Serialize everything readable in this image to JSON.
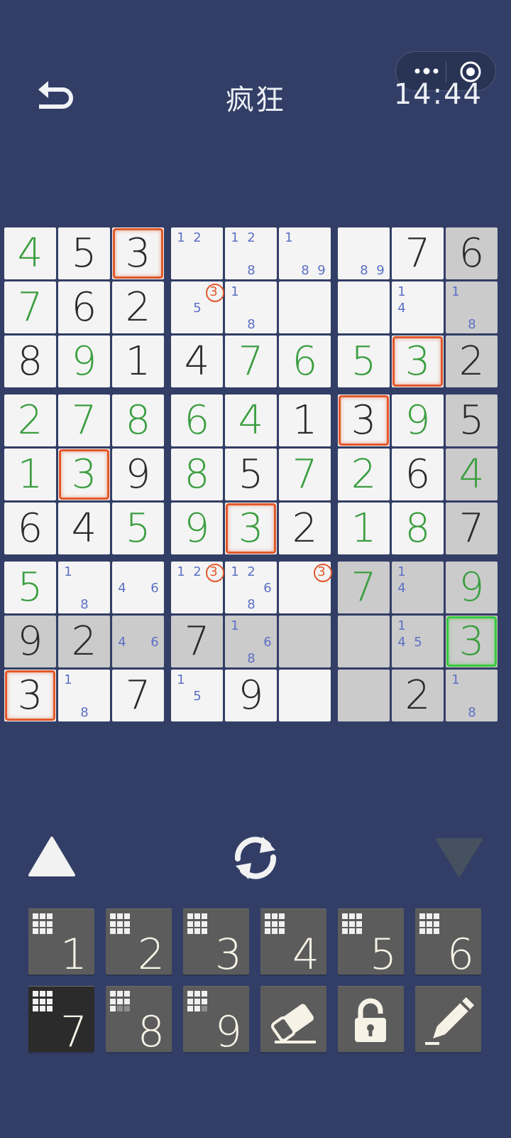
{
  "header": {
    "title": "疯狂",
    "clock": "14:44",
    "back_icon": "back-arrow-icon",
    "menu_icon": "more-dots-icon",
    "close_icon": "target-circle-icon"
  },
  "colors": {
    "background": "#323e66",
    "given_digit": "#2b2b2b",
    "user_digit": "#3a9e3f",
    "note_digit": "#5b70c4",
    "highlight_orange": "#e2582a",
    "highlight_green": "#37c93b",
    "key_bg": "#5c5c5c",
    "key_active_bg": "#2b2b2b"
  },
  "board": {
    "rows": [
      [
        {
          "v": "4",
          "t": "user"
        },
        {
          "v": "5",
          "t": "given"
        },
        {
          "v": "3",
          "t": "given",
          "hl": "orange"
        },
        {
          "notes": [
            "1",
            "2"
          ],
          "pos": [
            1,
            2
          ]
        },
        {
          "notes": [
            "1",
            "2",
            "8"
          ],
          "pos": [
            1,
            2,
            8
          ]
        },
        {
          "notes": [
            "1",
            "8",
            "9"
          ],
          "pos": [
            1,
            8,
            9
          ]
        },
        {
          "notes": [
            "8",
            "9"
          ],
          "pos": [
            8,
            9
          ]
        },
        {
          "v": "7",
          "t": "given"
        },
        {
          "v": "6",
          "t": "given",
          "shade": true
        }
      ],
      [
        {
          "v": "7",
          "t": "user"
        },
        {
          "v": "6",
          "t": "given"
        },
        {
          "v": "2",
          "t": "given"
        },
        {
          "notes": [
            "3",
            "5"
          ],
          "pos": [
            3,
            5
          ],
          "ring": [
            3
          ]
        },
        {
          "notes": [
            "1",
            "8"
          ],
          "pos": [
            1,
            8
          ]
        },
        {},
        {},
        {
          "notes": [
            "1",
            "4"
          ],
          "pos": [
            1,
            4
          ]
        },
        {
          "notes": [
            "1",
            "8"
          ],
          "pos": [
            1,
            8
          ],
          "shade": true
        }
      ],
      [
        {
          "v": "8",
          "t": "given"
        },
        {
          "v": "9",
          "t": "user"
        },
        {
          "v": "1",
          "t": "given"
        },
        {
          "v": "4",
          "t": "given"
        },
        {
          "v": "7",
          "t": "user"
        },
        {
          "v": "6",
          "t": "user"
        },
        {
          "v": "5",
          "t": "user"
        },
        {
          "v": "3",
          "t": "user",
          "hl": "orange"
        },
        {
          "v": "2",
          "t": "given",
          "shade": true
        }
      ],
      [
        {
          "v": "2",
          "t": "user"
        },
        {
          "v": "7",
          "t": "user"
        },
        {
          "v": "8",
          "t": "user"
        },
        {
          "v": "6",
          "t": "user"
        },
        {
          "v": "4",
          "t": "user"
        },
        {
          "v": "1",
          "t": "given"
        },
        {
          "v": "3",
          "t": "given",
          "hl": "orange"
        },
        {
          "v": "9",
          "t": "user"
        },
        {
          "v": "5",
          "t": "given",
          "shade": true
        }
      ],
      [
        {
          "v": "1",
          "t": "user"
        },
        {
          "v": "3",
          "t": "user",
          "hl": "orange"
        },
        {
          "v": "9",
          "t": "given"
        },
        {
          "v": "8",
          "t": "user"
        },
        {
          "v": "5",
          "t": "given"
        },
        {
          "v": "7",
          "t": "user"
        },
        {
          "v": "2",
          "t": "user"
        },
        {
          "v": "6",
          "t": "given"
        },
        {
          "v": "4",
          "t": "user",
          "shade": true
        }
      ],
      [
        {
          "v": "6",
          "t": "given"
        },
        {
          "v": "4",
          "t": "given"
        },
        {
          "v": "5",
          "t": "user"
        },
        {
          "v": "9",
          "t": "user"
        },
        {
          "v": "3",
          "t": "user",
          "hl": "orange"
        },
        {
          "v": "2",
          "t": "given"
        },
        {
          "v": "1",
          "t": "user"
        },
        {
          "v": "8",
          "t": "user"
        },
        {
          "v": "7",
          "t": "given",
          "shade": true
        }
      ],
      [
        {
          "v": "5",
          "t": "user"
        },
        {
          "notes": [
            "1",
            "8"
          ],
          "pos": [
            1,
            8
          ]
        },
        {
          "notes": [
            "4",
            "6"
          ],
          "pos": [
            4,
            6
          ]
        },
        {
          "notes": [
            "1",
            "2",
            "3"
          ],
          "pos": [
            1,
            2,
            3
          ],
          "ring": [
            3
          ]
        },
        {
          "notes": [
            "1",
            "2",
            "6",
            "8"
          ],
          "pos": [
            1,
            2,
            6,
            8
          ]
        },
        {
          "notes": [
            "3"
          ],
          "pos": [
            3
          ],
          "ring": [
            3
          ]
        },
        {
          "v": "7",
          "t": "user",
          "shade": true
        },
        {
          "notes": [
            "1",
            "4"
          ],
          "pos": [
            1,
            4
          ],
          "shade": true
        },
        {
          "v": "9",
          "t": "user",
          "shade": true
        }
      ],
      [
        {
          "v": "9",
          "t": "given",
          "shade": true
        },
        {
          "v": "2",
          "t": "given",
          "shade": true
        },
        {
          "notes": [
            "4",
            "6"
          ],
          "pos": [
            4,
            6
          ],
          "shade": true
        },
        {
          "v": "7",
          "t": "given",
          "shade": true
        },
        {
          "notes": [
            "1",
            "6",
            "8"
          ],
          "pos": [
            1,
            6,
            8
          ],
          "shade": true
        },
        {
          "shade": true
        },
        {
          "shade": true
        },
        {
          "notes": [
            "1",
            "4",
            "5"
          ],
          "pos": [
            1,
            4,
            5
          ],
          "shade": true
        },
        {
          "v": "3",
          "t": "user",
          "hl": "green",
          "shade": true
        }
      ],
      [
        {
          "v": "3",
          "t": "given",
          "hl": "orange"
        },
        {
          "notes": [
            "1",
            "8"
          ],
          "pos": [
            1,
            8
          ]
        },
        {
          "v": "7",
          "t": "given"
        },
        {
          "notes": [
            "1",
            "5"
          ],
          "pos": [
            1,
            5
          ]
        },
        {
          "v": "9",
          "t": "given"
        },
        {},
        {
          "shade": true
        },
        {
          "v": "2",
          "t": "given",
          "shade": true
        },
        {
          "notes": [
            "1",
            "8"
          ],
          "pos": [
            1,
            8
          ],
          "shade": true
        }
      ]
    ]
  },
  "controls": {
    "prev_icon": "triangle-up-icon",
    "refresh_icon": "refresh-icon",
    "next_icon": "triangle-down-icon"
  },
  "keypad": {
    "keys": [
      {
        "label": "1",
        "remaining": 9
      },
      {
        "label": "2",
        "remaining": 9
      },
      {
        "label": "3",
        "remaining": 9
      },
      {
        "label": "4",
        "remaining": 9
      },
      {
        "label": "5",
        "remaining": 9
      },
      {
        "label": "6",
        "remaining": 9
      },
      {
        "label": "7",
        "remaining": 9,
        "active": true
      },
      {
        "label": "8",
        "remaining": 7
      },
      {
        "label": "9",
        "remaining": 8
      }
    ],
    "tools": [
      "eraser-icon",
      "lock-icon",
      "pencil-icon"
    ]
  }
}
